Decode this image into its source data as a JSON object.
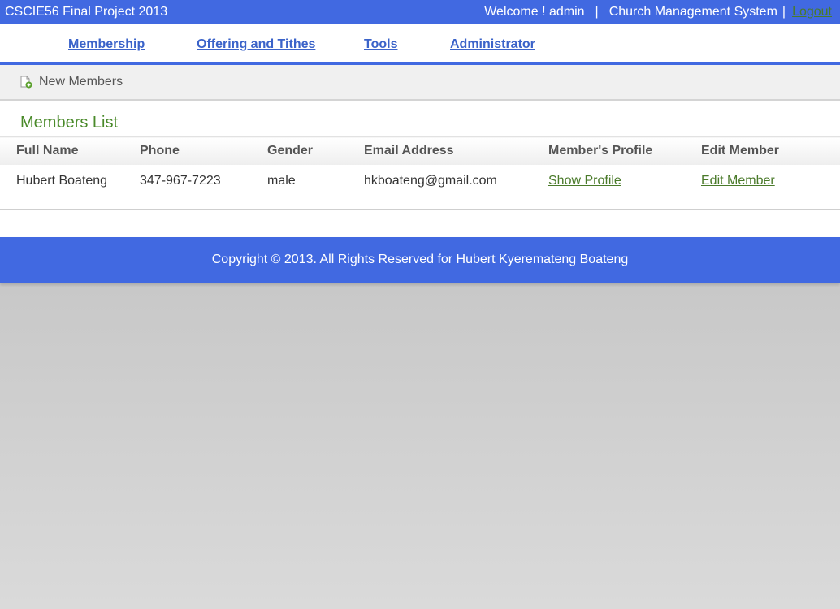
{
  "header": {
    "site_title": "CSCIE56 Final Project 2013",
    "welcome_text": "Welcome ! admin",
    "separator": "|",
    "system_name": "Church Management System",
    "logout_label": "Logout"
  },
  "nav": {
    "items": [
      {
        "label": "Membership"
      },
      {
        "label": "Offering and Tithes"
      },
      {
        "label": "Tools"
      },
      {
        "label": "Administrator"
      }
    ]
  },
  "subnav": {
    "new_members_label": "New Members",
    "icon": "add-document-icon"
  },
  "main": {
    "section_title": "Members List",
    "columns": [
      "Full Name",
      "Phone",
      "Gender",
      "Email Address",
      "Member's Profile",
      "Edit Member"
    ],
    "rows": [
      {
        "full_name": "Hubert Boateng",
        "phone": "347-967-7223",
        "gender": "male",
        "email": "hkboateng@gmail.com",
        "profile_link": "Show Profile",
        "edit_link": "Edit Member"
      }
    ]
  },
  "footer": {
    "copyright": "Copyright © 2013. All Rights Reserved for Hubert Kyeremateng Boateng"
  },
  "colors": {
    "brand_blue": "#4169e1",
    "accent_green": "#4a8a2a",
    "nav_link": "#3b63c9"
  }
}
